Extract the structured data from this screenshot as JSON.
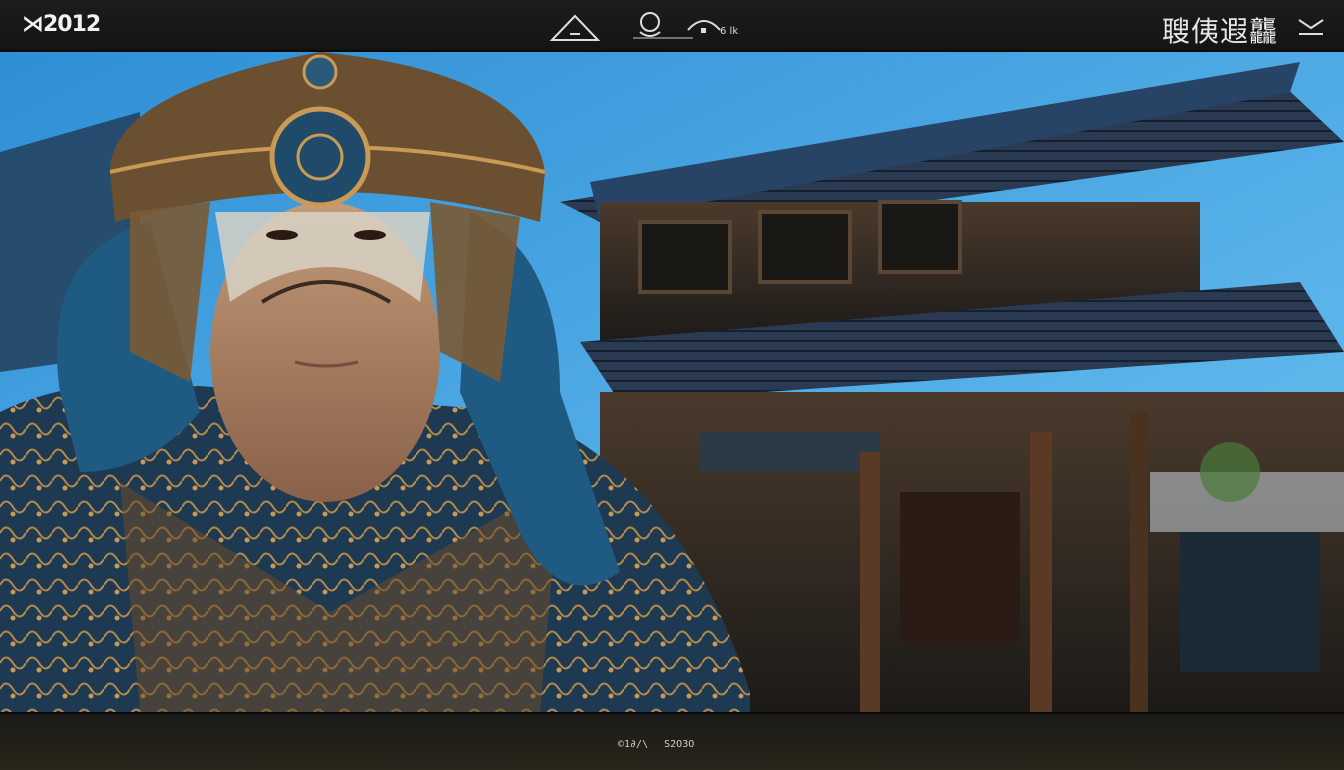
{
  "hud": {
    "brand": "⋊2012",
    "title_right": "䏂侇遐龘",
    "close_icon": "close-icon",
    "center_icons": [
      "mountain-icon",
      "compass-icon",
      "camp-icon"
    ],
    "center_label": "6 lk"
  },
  "footer": {
    "status_left": "©1∂/\\",
    "status_right": "S2O3O"
  },
  "colors": {
    "bar_bg": "#161614",
    "sky": "#3aa0e0",
    "armor_gold": "#b5894a",
    "hood_blue": "#1f5a82",
    "roof_blue": "#2e4e78"
  }
}
